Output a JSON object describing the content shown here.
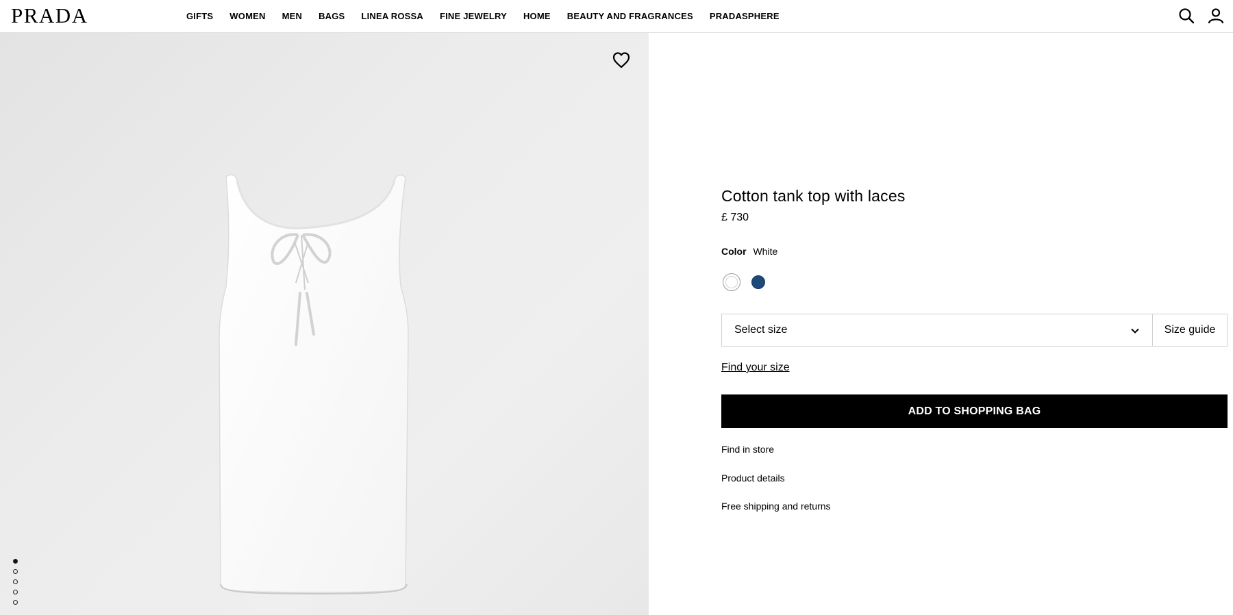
{
  "brand": {
    "logo_text": "PRADA"
  },
  "nav": {
    "items": [
      "GIFTS",
      "WOMEN",
      "MEN",
      "BAGS",
      "LINEA ROSSA",
      "FINE JEWELRY",
      "HOME",
      "BEAUTY AND FRAGRANCES",
      "PRADASPHERE"
    ]
  },
  "header_icons": {
    "search": "search-icon",
    "account": "account-icon"
  },
  "product": {
    "title": "Cotton tank top with laces",
    "price": "£ 730",
    "color_label": "Color",
    "color_value": "White",
    "swatches": [
      {
        "name": "White",
        "hex": "#ffffff",
        "selected": true
      },
      {
        "name": "Blue",
        "hex": "#1d4a78",
        "selected": false
      }
    ],
    "size_placeholder": "Select size",
    "size_guide": "Size guide",
    "find_size": "Find your size",
    "add_to_bag": "ADD TO SHOPPING BAG",
    "links": [
      "Find in store",
      "Product details",
      "Free shipping and returns"
    ]
  },
  "gallery": {
    "image_count": 5,
    "active_index": 0,
    "wishlist_icon": "heart-icon"
  }
}
